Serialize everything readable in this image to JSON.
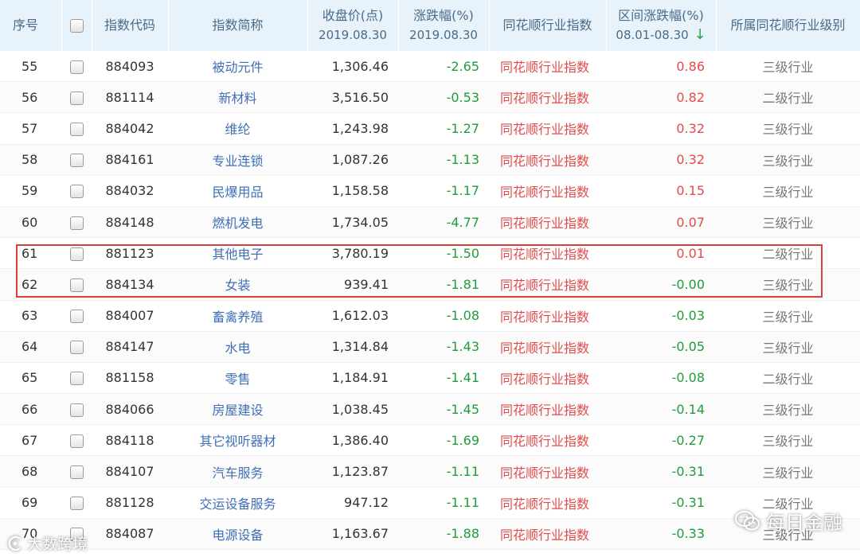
{
  "colors": {
    "up": "#e34b4b",
    "down": "#1f9d3a",
    "header_bg": "#e8f2fb",
    "link": "#3f6fb6",
    "highlight": "#d9413a"
  },
  "headers": {
    "idx": "序号",
    "code": "指数代码",
    "name": "指数简称",
    "close": "收盘价(点)",
    "close_date": "2019.08.30",
    "chg": "涨跌幅(%)",
    "chg_date": "2019.08.30",
    "type": "同花顺行业指数",
    "range": "区间涨跌幅(%)",
    "range_period": "08.01-08.30",
    "level": "所属同花顺行业级别"
  },
  "rows": [
    {
      "idx": "55",
      "code": "884093",
      "name": "被动元件",
      "close": "1,306.46",
      "chg": "-2.65",
      "type": "同花顺行业指数",
      "range": "0.86",
      "level": "三级行业"
    },
    {
      "idx": "56",
      "code": "881114",
      "name": "新材料",
      "close": "3,516.50",
      "chg": "-0.53",
      "type": "同花顺行业指数",
      "range": "0.82",
      "level": "二级行业"
    },
    {
      "idx": "57",
      "code": "884042",
      "name": "维纶",
      "close": "1,243.98",
      "chg": "-1.27",
      "type": "同花顺行业指数",
      "range": "0.32",
      "level": "三级行业"
    },
    {
      "idx": "58",
      "code": "884161",
      "name": "专业连锁",
      "close": "1,087.26",
      "chg": "-1.13",
      "type": "同花顺行业指数",
      "range": "0.32",
      "level": "三级行业"
    },
    {
      "idx": "59",
      "code": "884032",
      "name": "民爆用品",
      "close": "1,158.58",
      "chg": "-1.17",
      "type": "同花顺行业指数",
      "range": "0.15",
      "level": "三级行业"
    },
    {
      "idx": "60",
      "code": "884148",
      "name": "燃机发电",
      "close": "1,734.05",
      "chg": "-4.77",
      "type": "同花顺行业指数",
      "range": "0.07",
      "level": "三级行业"
    },
    {
      "idx": "61",
      "code": "881123",
      "name": "其他电子",
      "close": "3,780.19",
      "chg": "-1.50",
      "type": "同花顺行业指数",
      "range": "0.01",
      "level": "二级行业"
    },
    {
      "idx": "62",
      "code": "884134",
      "name": "女装",
      "close": "939.41",
      "chg": "-1.81",
      "type": "同花顺行业指数",
      "range": "-0.00",
      "level": "三级行业"
    },
    {
      "idx": "63",
      "code": "884007",
      "name": "畜禽养殖",
      "close": "1,612.03",
      "chg": "-1.08",
      "type": "同花顺行业指数",
      "range": "-0.03",
      "level": "三级行业"
    },
    {
      "idx": "64",
      "code": "884147",
      "name": "水电",
      "close": "1,314.84",
      "chg": "-1.43",
      "type": "同花顺行业指数",
      "range": "-0.05",
      "level": "三级行业"
    },
    {
      "idx": "65",
      "code": "881158",
      "name": "零售",
      "close": "1,184.91",
      "chg": "-1.41",
      "type": "同花顺行业指数",
      "range": "-0.08",
      "level": "二级行业"
    },
    {
      "idx": "66",
      "code": "884066",
      "name": "房屋建设",
      "close": "1,038.45",
      "chg": "-1.45",
      "type": "同花顺行业指数",
      "range": "-0.14",
      "level": "三级行业"
    },
    {
      "idx": "67",
      "code": "884118",
      "name": "其它视听器材",
      "close": "1,386.40",
      "chg": "-1.69",
      "type": "同花顺行业指数",
      "range": "-0.27",
      "level": "三级行业"
    },
    {
      "idx": "68",
      "code": "884107",
      "name": "汽车服务",
      "close": "1,123.87",
      "chg": "-1.11",
      "type": "同花顺行业指数",
      "range": "-0.31",
      "level": "三级行业"
    },
    {
      "idx": "69",
      "code": "881128",
      "name": "交运设备服务",
      "close": "947.12",
      "chg": "-1.11",
      "type": "同花顺行业指数",
      "range": "-0.31",
      "level": "二级行业"
    },
    {
      "idx": "70",
      "code": "884087",
      "name": "电源设备",
      "close": "1,163.67",
      "chg": "-1.88",
      "type": "同花顺行业指数",
      "range": "-0.33",
      "level": "三级行业"
    }
  ],
  "watermarks": {
    "left": "大数跨境",
    "right": "每日金融"
  }
}
